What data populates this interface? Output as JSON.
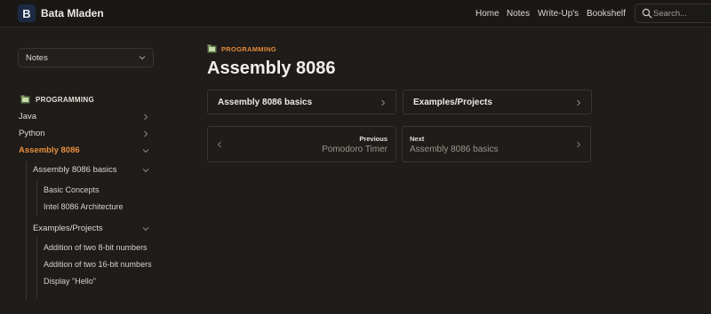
{
  "header": {
    "logo_letter": "B",
    "site_title": "Bata Mladen",
    "nav": [
      "Home",
      "Notes",
      "Write-Up's",
      "Bookshelf"
    ],
    "search_placeholder": "Search..."
  },
  "sidebar": {
    "select_value": "Notes",
    "section_title": "PROGRAMMING",
    "items": [
      {
        "label": "Java"
      },
      {
        "label": "Python"
      },
      {
        "label": "Assembly 8086"
      }
    ],
    "sub_items": [
      {
        "label": "Assembly 8086 basics"
      },
      {
        "label": "Examples/Projects"
      }
    ],
    "basics_children": [
      "Basic Concepts",
      "Intel 8086 Architecture"
    ],
    "project_children": [
      "Addition of two 8-bit numbers",
      "Addition of two 16-bit numbers",
      "Display \"Hello\""
    ]
  },
  "main": {
    "breadcrumb": "PROGRAMMING",
    "title": "Assembly 8086",
    "cards": [
      "Assembly 8086 basics",
      "Examples/Projects"
    ],
    "previous": {
      "kicker": "Previous",
      "title": "Pomodoro Timer"
    },
    "next": {
      "kicker": "Next",
      "title": "Assembly 8086 basics"
    }
  },
  "colors": {
    "accent": "#e88e3e",
    "background": "#1f1c19",
    "logo_bg": "#1c2b43"
  }
}
